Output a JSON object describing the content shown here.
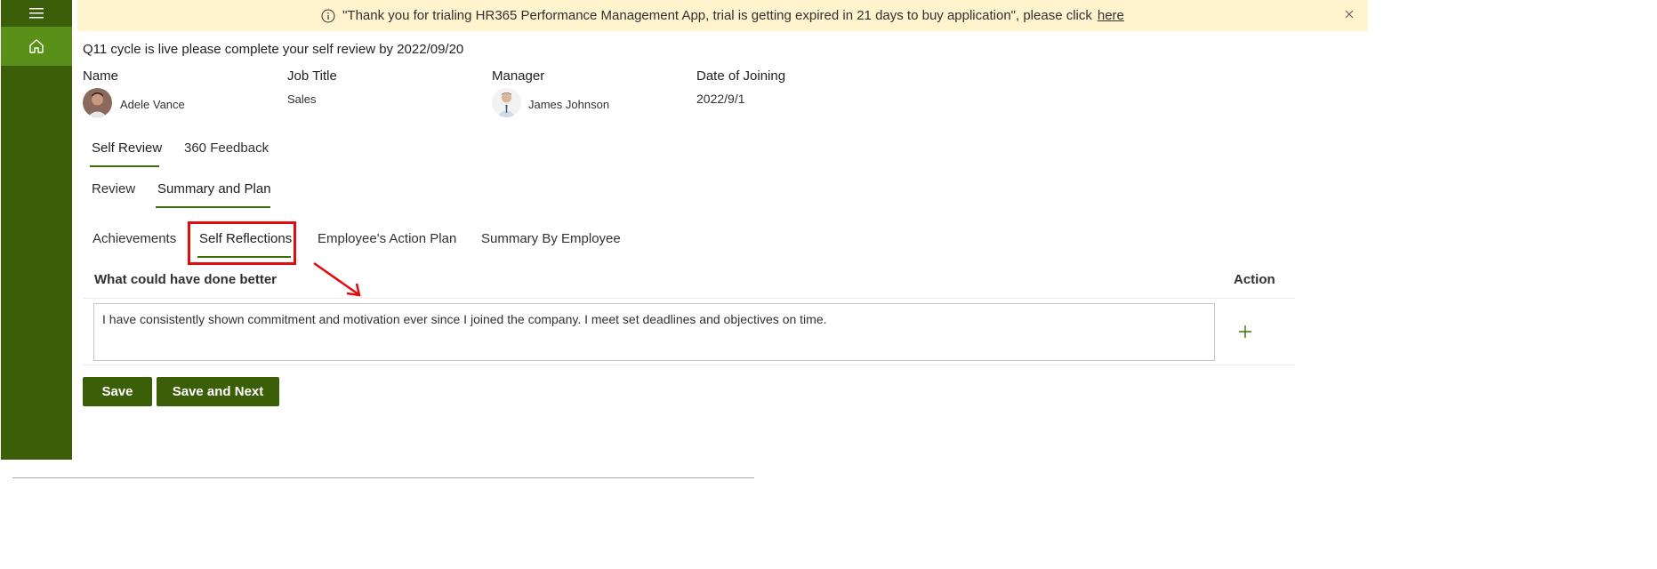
{
  "colors": {
    "sidebar": "#3b5e08",
    "sidebar_active": "#5a8f1a",
    "banner_bg": "#fff4ce",
    "accent_underline": "#3b6e0b",
    "highlight_red": "#e30b0b"
  },
  "sidebar": {
    "menu_icon": "hamburger-icon",
    "home_icon": "home-icon"
  },
  "banner": {
    "message": "\"Thank you for trialing HR365 Performance Management App, trial is getting expired in 21 days to buy application\", please click",
    "link": "here",
    "info_icon": "info-icon",
    "close_icon": "close-icon"
  },
  "notice": "Q11 cycle is live please complete your self review by 2022/09/20",
  "profile": {
    "name_label": "Name",
    "name_value": "Adele Vance",
    "job_title_label": "Job Title",
    "job_title_value": "Sales",
    "manager_label": "Manager",
    "manager_value": "James Johnson",
    "doj_label": "Date of Joining",
    "doj_value": "2022/9/1"
  },
  "main_tabs": [
    {
      "label": "Self Review",
      "active": true
    },
    {
      "label": "360 Feedback",
      "active": false
    }
  ],
  "sub_tabs": [
    {
      "label": "Review",
      "active": false
    },
    {
      "label": "Summary and Plan",
      "active": true
    }
  ],
  "section_tabs": [
    {
      "label": "Achievements",
      "active": false
    },
    {
      "label": "Self Reflections",
      "active": true
    },
    {
      "label": "Employee's Action Plan",
      "active": false
    },
    {
      "label": "Summary By Employee",
      "active": false
    }
  ],
  "table": {
    "column_question": "What could have done better",
    "column_action": "Action",
    "entry_text": "I have consistently shown commitment and motivation ever since I joined the company. I meet set deadlines and objectives on time.",
    "add_icon": "plus-icon"
  },
  "buttons": {
    "save": "Save",
    "save_next": "Save and Next"
  }
}
